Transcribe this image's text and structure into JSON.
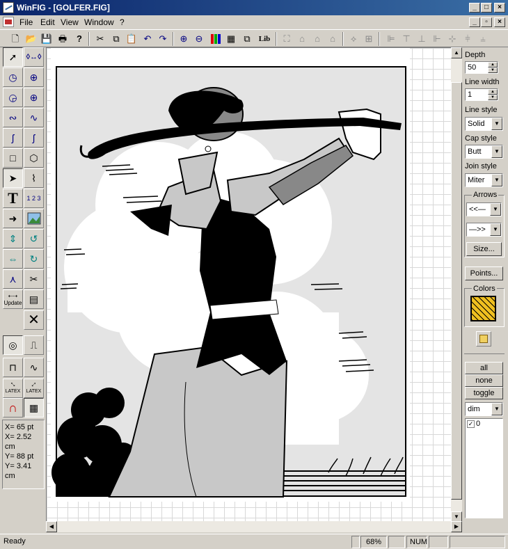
{
  "window": {
    "title": "WinFIG - [GOLFER.FIG]"
  },
  "menu": {
    "items": [
      "File",
      "Edit",
      "View",
      "Window",
      "?"
    ]
  },
  "toolbar": {
    "lib_label": "Lib"
  },
  "lefttools": {
    "update_label": "Update",
    "latex1": "LATEX",
    "latex2": "LATEX"
  },
  "coords": {
    "x_pt": "X= 65 pt",
    "x_cm": "X= 2.52 cm",
    "y_pt": "Y= 88 pt",
    "y_cm": "Y= 3.41 cm"
  },
  "panel": {
    "depth_label": "Depth",
    "depth_value": "50",
    "linewidth_label": "Line width",
    "linewidth_value": "1",
    "linestyle_label": "Line style",
    "linestyle_value": "Solid",
    "capstyle_label": "Cap style",
    "capstyle_value": "Butt",
    "joinstyle_label": "Join style",
    "joinstyle_value": "Miter",
    "arrows_label": "Arrows",
    "size_button": "Size...",
    "points_button": "Points...",
    "colors_label": "Colors",
    "fill_color": "#f0c020",
    "all_button": "all",
    "none_button": "none",
    "toggle_button": "toggle",
    "dim_value": "dim",
    "layer_0": "0"
  },
  "status": {
    "ready": "Ready",
    "zoom": "68%",
    "num": "NUM"
  }
}
